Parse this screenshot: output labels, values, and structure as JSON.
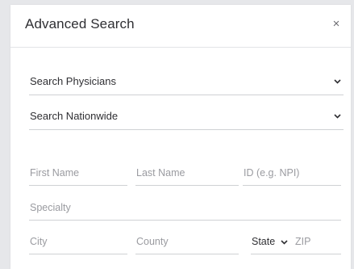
{
  "dialog": {
    "title": "Advanced Search",
    "close_label": "×"
  },
  "search_type": {
    "selected": "Search Physicians"
  },
  "search_scope": {
    "selected": "Search Nationwide"
  },
  "fields": {
    "first_name": {
      "placeholder": "First Name",
      "value": ""
    },
    "last_name": {
      "placeholder": "Last Name",
      "value": ""
    },
    "id": {
      "placeholder": "ID (e.g. NPI)",
      "value": ""
    },
    "specialty": {
      "placeholder": "Specialty",
      "value": ""
    },
    "city": {
      "placeholder": "City",
      "value": ""
    },
    "county": {
      "placeholder": "County",
      "value": ""
    },
    "state": {
      "selected": "State"
    },
    "zip": {
      "placeholder": "ZIP",
      "value": ""
    }
  },
  "icons": {
    "dropdown": "chevron-down-icon",
    "close": "close-icon"
  },
  "colors": {
    "background": "#e6e7ea",
    "panel": "#ffffff",
    "text": "#2f2f33",
    "placeholder": "#9a9ba0",
    "divider": "#cfd1d4"
  }
}
